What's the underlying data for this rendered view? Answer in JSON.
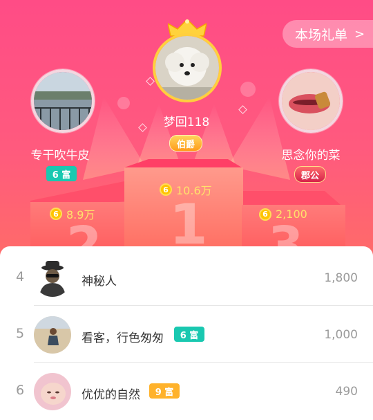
{
  "header": {
    "gift_list_label": "本场礼单"
  },
  "podium": {
    "first": {
      "name": "梦回118",
      "badge": "伯爵",
      "score": "10.6万",
      "rank": "1"
    },
    "second": {
      "name": "专干吹牛皮",
      "badge": "6 富",
      "score": "8.9万",
      "rank": "2"
    },
    "third": {
      "name": "思念你的菜",
      "badge": "郡公",
      "score": "2,100",
      "rank": "3"
    }
  },
  "list": [
    {
      "rank": "4",
      "name": "神秘人",
      "badge": "",
      "score": "1,800"
    },
    {
      "rank": "5",
      "name": "看客，行色匆匆",
      "badge": "6 富",
      "score": "1,000"
    },
    {
      "rank": "6",
      "name": "优优的自然",
      "badge": "9 富",
      "score": "490"
    }
  ],
  "coin_glyph": "6"
}
